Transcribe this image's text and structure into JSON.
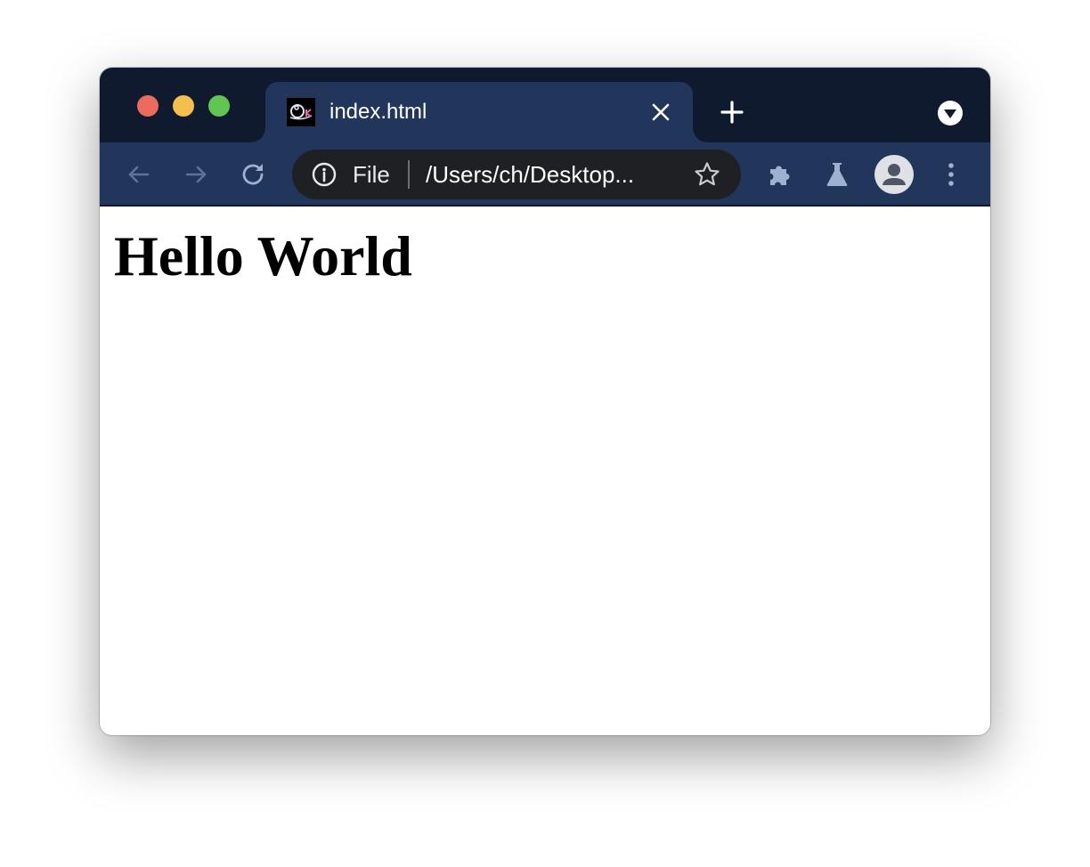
{
  "window": {
    "traffic_lights": [
      "close",
      "minimize",
      "zoom"
    ],
    "colors": {
      "titlebar": "#0f1a2e",
      "toolbar": "#22355a",
      "omnibox": "#1f2023",
      "close": "#ed6a5e",
      "minimize": "#f5bf4f",
      "zoom": "#61c554"
    }
  },
  "tab": {
    "title": "index.html",
    "favicon": "chrome-canary-favicon",
    "close_icon": "close-icon"
  },
  "tabstrip": {
    "new_tab_icon": "plus-icon",
    "tab_search_icon": "chevron-down-circle-icon"
  },
  "toolbar": {
    "back_icon": "arrow-left-icon",
    "forward_icon": "arrow-right-icon",
    "reload_icon": "reload-icon",
    "extensions_icon": "puzzle-icon",
    "labs_icon": "flask-icon",
    "profile_icon": "avatar-icon",
    "menu_icon": "kebab-menu-icon"
  },
  "omnibox": {
    "info_icon": "info-icon",
    "scheme_label": "File",
    "url": "/Users/ch/Desktop...",
    "bookmark_icon": "star-icon"
  },
  "page": {
    "heading": "Hello World"
  }
}
